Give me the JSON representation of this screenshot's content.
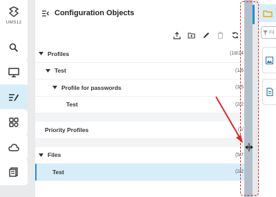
{
  "app": {
    "brand": "UMS12"
  },
  "panel": {
    "title": "Configuration Objects"
  },
  "toolbar": {
    "icons": [
      "upload-icon",
      "new-folder-icon",
      "edit-icon",
      "delete-icon",
      "refresh-icon"
    ]
  },
  "tree": {
    "rows": [
      {
        "label": "Profiles",
        "count": "(18/24",
        "level": 0,
        "expanded": true
      },
      {
        "label": "Test",
        "count": "(1/6",
        "level": 1,
        "expanded": true
      },
      {
        "label": "Profile for passwords",
        "count": "(3/5",
        "level": 2,
        "expanded": true
      },
      {
        "label": "Test",
        "count": "(2/2",
        "level": 3
      },
      {
        "label": "Priority Profiles",
        "count": "(1/",
        "level": 0
      },
      {
        "label": "Files",
        "count": "(5/7",
        "level": 0,
        "expanded": true
      },
      {
        "label": "Test",
        "count": "(2/2",
        "level": 1,
        "selected": true
      }
    ]
  },
  "right_panel": {
    "filter_placeholder": "Fil"
  },
  "colors": {
    "accent": "#1e8fd6",
    "selected_bg": "#d7eef9",
    "annotation": "#e02424",
    "folder": "#f0a500"
  }
}
